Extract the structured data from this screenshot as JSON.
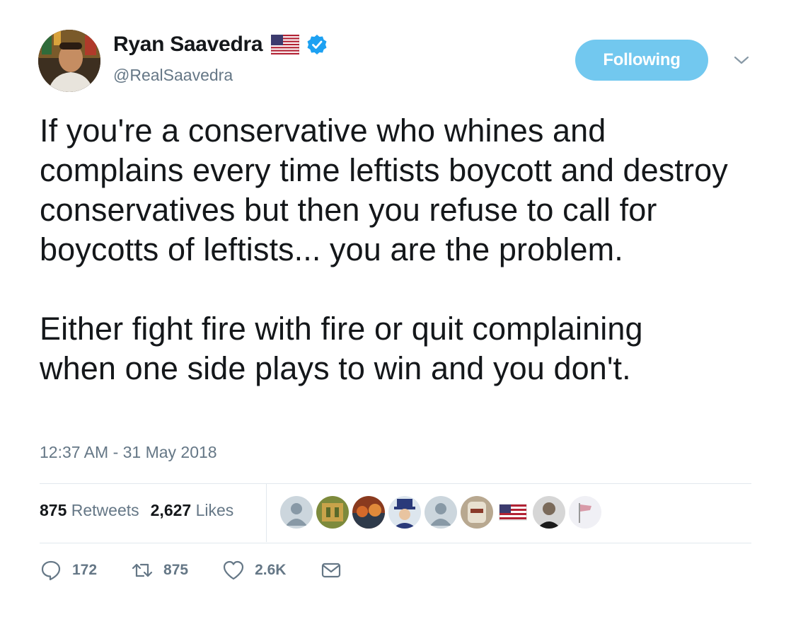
{
  "author": {
    "display_name": "Ryan Saavedra",
    "handle": "@RealSaavedra"
  },
  "follow_button": {
    "label": "Following"
  },
  "tweet": {
    "paragraphs": [
      "If you're a conservative who whines and complains every time leftists boycott and destroy conservatives but then you refuse to call for boycotts of leftists... you are the problem.",
      "Either fight fire with fire or quit complaining when one side plays to win and you don't."
    ],
    "timestamp": "12:37 AM - 31 May 2018"
  },
  "stats": {
    "retweets_count": "875",
    "retweets_label": "Retweets",
    "likes_count": "2,627",
    "likes_label": "Likes"
  },
  "actions": {
    "reply_count": "172",
    "retweet_count": "875",
    "like_count": "2.6K"
  },
  "colors": {
    "follow_bg": "#72c8ef",
    "verified": "#1da1f2",
    "secondary_text": "#657786"
  },
  "icons": [
    "caret-down-icon",
    "verified-icon",
    "us-flag-icon",
    "reply-icon",
    "retweet-icon",
    "like-icon",
    "message-icon"
  ]
}
